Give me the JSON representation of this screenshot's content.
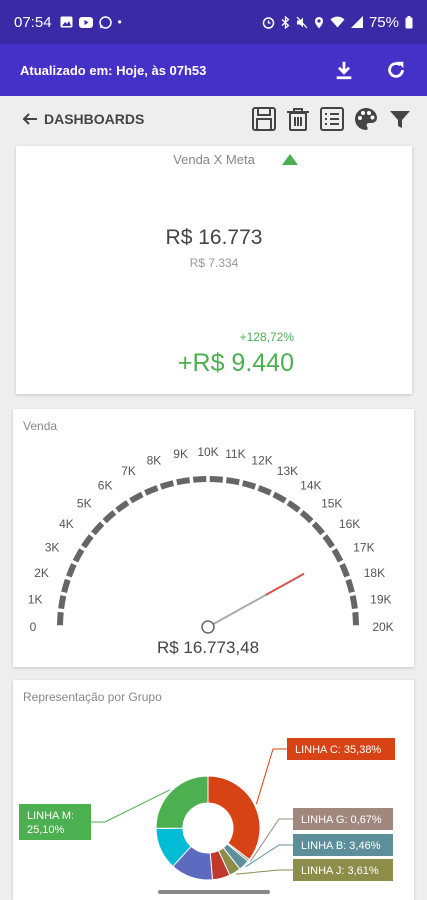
{
  "statusbar": {
    "time": "07:54",
    "battery": "75%",
    "left_icons": [
      "image-icon",
      "youtube-icon",
      "whatsapp-icon",
      "dot-icon"
    ],
    "right_icons": [
      "alarm-icon",
      "bluetooth-icon",
      "mute-icon",
      "location-icon",
      "wifi-icon",
      "signal-icon",
      "battery-icon"
    ]
  },
  "appbar": {
    "updated": "Atualizado em: Hoje, às 07h53",
    "icons": [
      "download-icon",
      "refresh-icon"
    ]
  },
  "toolbar": {
    "back_label": "DASHBOARDS",
    "icons": [
      "save-icon",
      "trash-icon",
      "list-icon",
      "palette-icon",
      "filter-icon"
    ]
  },
  "card_meta": {
    "title": "Venda X Meta",
    "value": "R$ 16.773",
    "target": "R$ 7.334",
    "percent": "+128,72%",
    "difference": "+R$ 9.440",
    "accent": "#4caf50"
  },
  "card_gauge": {
    "title": "Venda",
    "ticks": [
      "0",
      "1K",
      "2K",
      "3K",
      "4K",
      "5K",
      "6K",
      "7K",
      "8K",
      "9K",
      "10K",
      "11K",
      "12K",
      "13K",
      "14K",
      "15K",
      "16K",
      "17K",
      "18K",
      "19K",
      "20K"
    ],
    "min": 0,
    "max": 20000,
    "value": 16773.48,
    "value_label": "R$ 16.773,48",
    "needle_color": "#d9534f",
    "arc_color": "#666666"
  },
  "card_pie": {
    "title": "Representação por Grupo",
    "chart_data": {
      "type": "pie",
      "slices": [
        {
          "name": "LINHA C: 35,38%",
          "value": 35.38,
          "color": "#d84315"
        },
        {
          "name": "LINHA G: 0,67%",
          "value": 0.67,
          "color": "#a1887f"
        },
        {
          "name": "LINHA B: 3,46%",
          "value": 3.46,
          "color": "#5d8f9a"
        },
        {
          "name": "LINHA J: 3,61%",
          "value": 3.61,
          "color": "#8d8d4a"
        },
        {
          "name": "",
          "value": 5.5,
          "color": "#c0392b"
        },
        {
          "name": "",
          "value": 13.2,
          "color": "#5c6bc0"
        },
        {
          "name": "",
          "value": 13.1,
          "color": "#00bcd4"
        },
        {
          "name": "LINHA M: 25,10%",
          "value": 25.1,
          "color": "#4caf50"
        }
      ]
    }
  }
}
